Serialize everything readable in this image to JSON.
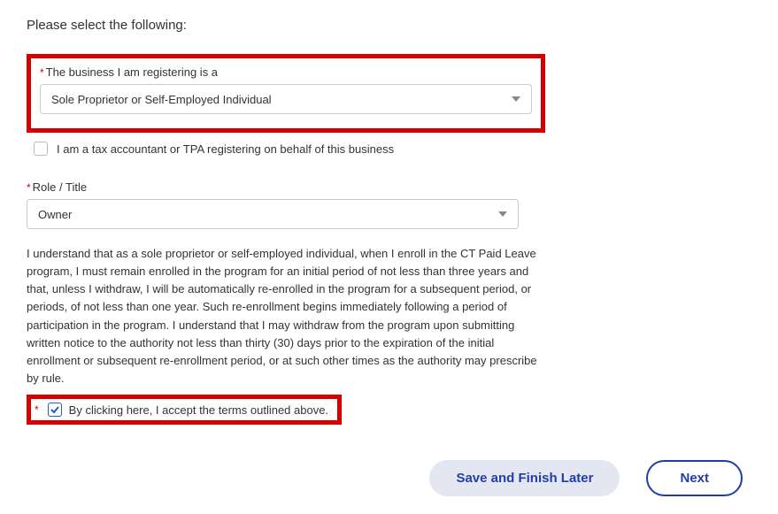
{
  "page_prompt": "Please select the following:",
  "business_type": {
    "label": "The business I am registering is a",
    "selected": "Sole Proprietor or Self-Employed Individual"
  },
  "tpa_checkbox": {
    "label": "I am a tax accountant or TPA registering on behalf of this business",
    "checked": false
  },
  "role": {
    "label": "Role / Title",
    "selected": "Owner"
  },
  "terms_text": "I understand that as a sole proprietor or self-employed individual, when I enroll in the CT Paid Leave program, I must remain enrolled in the program for an initial period of not less than three years and that, unless I withdraw, I will be automatically re-enrolled in the program for a subsequent period, or periods, of not less than one year. Such re-enrollment begins immediately following a period of participation in the program. I understand that I may withdraw from the program upon submitting written notice to the authority not less than thirty (30) days prior to the expiration of the initial enrollment or subsequent re-enrollment period, or at such other times as the authority may prescribe by rule.",
  "accept_checkbox": {
    "label": "By clicking here, I accept the terms outlined above.",
    "checked": true
  },
  "buttons": {
    "save_later": "Save and Finish Later",
    "next": "Next"
  },
  "required_mark": "*"
}
